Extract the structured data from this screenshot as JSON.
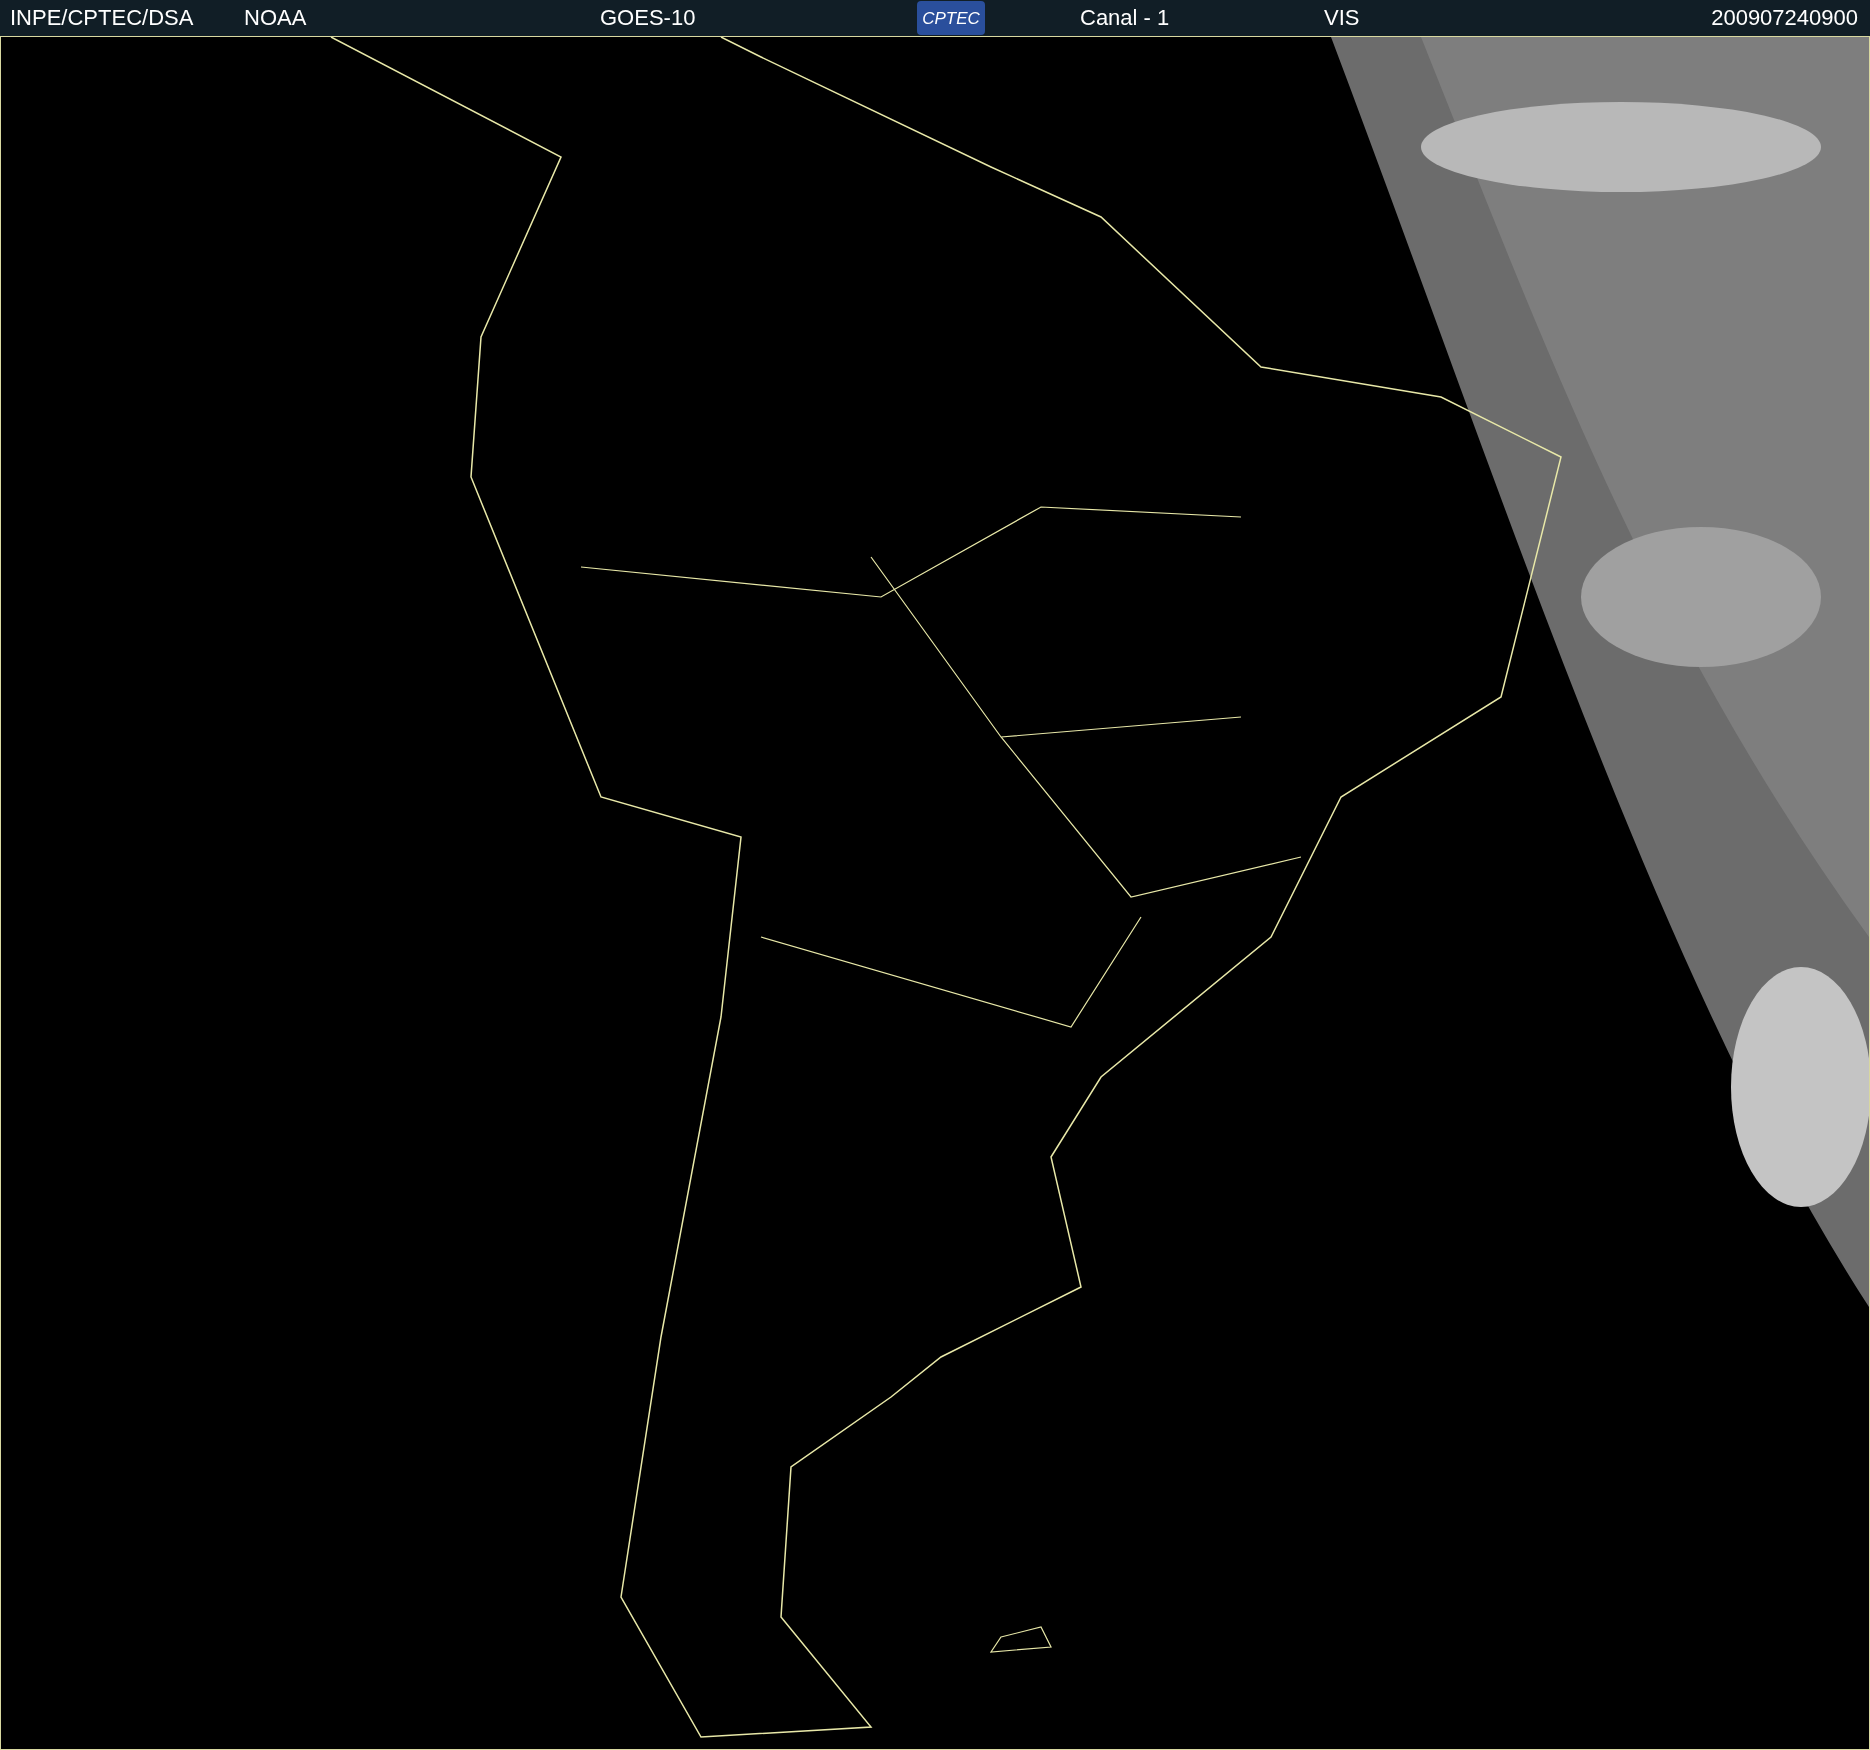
{
  "header": {
    "left": [
      "INPE/CPTEC/DSA",
      "NOAA",
      "GOES-10"
    ],
    "logo": "CPTEC",
    "right": [
      "Canal - 1",
      "VIS"
    ],
    "timestamp": "200907240900"
  }
}
